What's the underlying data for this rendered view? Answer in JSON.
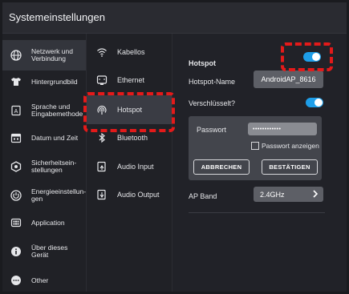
{
  "window": {
    "title": "Systemeinstellungen"
  },
  "nav": {
    "items": [
      {
        "label": "Netzwerk und\nVerbindung",
        "icon": "globe-icon"
      },
      {
        "label": "Hintergrundbild",
        "icon": "shirt-icon"
      },
      {
        "label": "Sprache und\nEingabemethode",
        "icon": "keyboard-a-icon"
      },
      {
        "label": "Datum und Zeit",
        "icon": "calendar-icon"
      },
      {
        "label": "Sicherheitsein-\nstellungen",
        "icon": "security-icon"
      },
      {
        "label": "Energieeinstellun-\ngen",
        "icon": "power-icon"
      },
      {
        "label": "Application",
        "icon": "apps-icon"
      },
      {
        "label": "Über dieses Gerät",
        "icon": "info-icon"
      },
      {
        "label": "Other",
        "icon": "more-icon"
      }
    ],
    "active_index": 0
  },
  "subnav": {
    "items": [
      {
        "label": "Kabellos",
        "icon": "wifi-icon"
      },
      {
        "label": "Ethernet",
        "icon": "ethernet-icon"
      },
      {
        "label": "Hotspot",
        "icon": "hotspot-icon"
      },
      {
        "label": "Bluetooth",
        "icon": "bluetooth-icon"
      },
      {
        "label": "Audio Input",
        "icon": "audio-input-icon"
      },
      {
        "label": "Audio Output",
        "icon": "audio-output-icon"
      }
    ],
    "active_index": 2
  },
  "hotspot": {
    "title": "Hotspot",
    "enabled": true,
    "name_label": "Hotspot-Name",
    "name_value": "AndroidAP_8616",
    "encrypted_label": "Verschlüsselt?",
    "encrypted": true,
    "password_label": "Passwort",
    "password_value": "••••••••••••",
    "show_password_label": "Passwort anzeigen",
    "show_password_checked": false,
    "cancel_label": "ABBRECHEN",
    "confirm_label": "BESTÄTIGEN",
    "ap_band_label": "AP Band",
    "ap_band_value": "2.4GHz"
  },
  "colors": {
    "accent": "#1e9ee8",
    "highlight": "#e31a1a"
  }
}
